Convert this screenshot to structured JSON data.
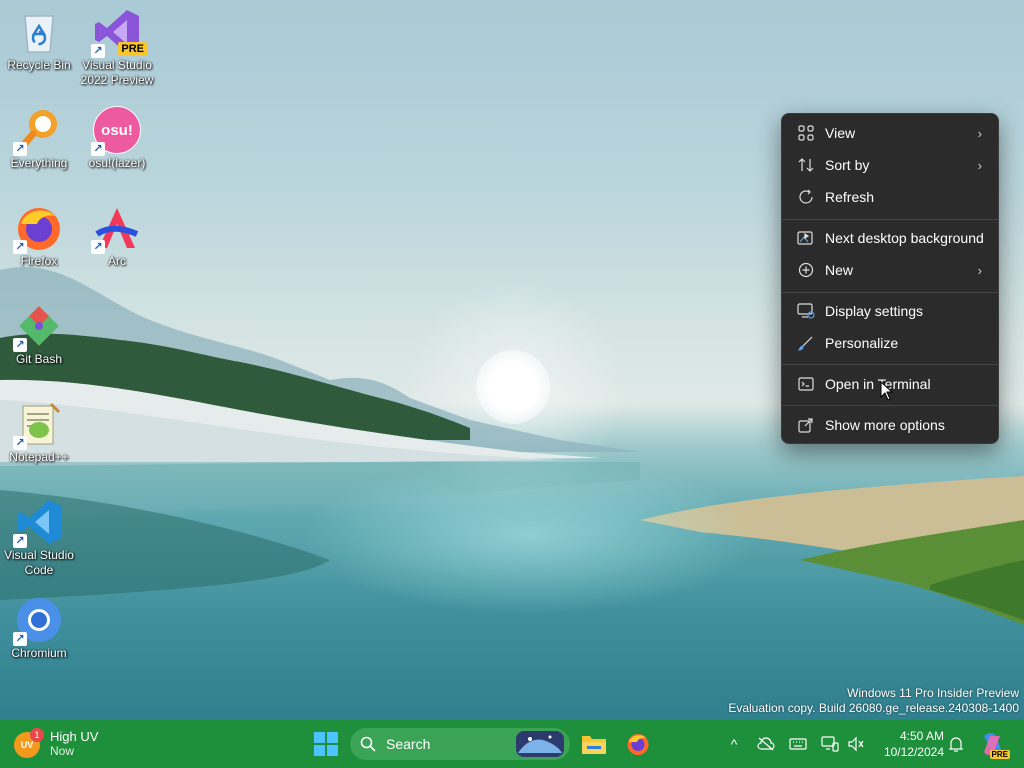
{
  "desktop": {
    "icons": [
      {
        "label": "Recycle Bin"
      },
      {
        "label": "Visual Studio 2022 Preview",
        "badge": "PRE"
      },
      {
        "label": "Everything"
      },
      {
        "label": "osu!(lazer)",
        "badge": "osu!"
      },
      {
        "label": "Firefox"
      },
      {
        "label": "Arc"
      },
      {
        "label": "Git Bash"
      },
      {
        "label": "Notepad++"
      },
      {
        "label": "Visual Studio Code"
      },
      {
        "label": "Chromium"
      }
    ]
  },
  "context_menu": {
    "items": [
      {
        "label": "View",
        "icon": "grid-icon",
        "submenu": true
      },
      {
        "label": "Sort by",
        "icon": "sort-icon",
        "submenu": true
      },
      {
        "label": "Refresh",
        "icon": "refresh-icon",
        "submenu": false
      },
      {
        "label": "Next desktop background",
        "icon": "next-background-icon",
        "submenu": false
      },
      {
        "label": "New",
        "icon": "plus-circle-icon",
        "submenu": true
      },
      {
        "label": "Display settings",
        "icon": "display-icon",
        "submenu": false
      },
      {
        "label": "Personalize",
        "icon": "brush-icon",
        "submenu": false
      },
      {
        "label": "Open in Terminal",
        "icon": "terminal-icon",
        "submenu": false
      },
      {
        "label": "Show more options",
        "icon": "share-icon",
        "submenu": false
      }
    ],
    "submenu_arrow": "›"
  },
  "watermark": {
    "line1": "Windows 11 Pro Insider Preview",
    "line2": "Evaluation copy. Build 26080.ge_release.240308-1400"
  },
  "taskbar": {
    "weather": {
      "badge": "1",
      "title": "High UV",
      "subtitle": "Now",
      "avatar": "UV"
    },
    "search_placeholder": "Search",
    "clock": {
      "time": "4:50 AM",
      "date": "10/12/2024"
    },
    "tray_chevron": "^",
    "copilot_badge": "PRE",
    "colors": {
      "taskbar": "#1e8f3a",
      "search": "#3aa356"
    }
  }
}
